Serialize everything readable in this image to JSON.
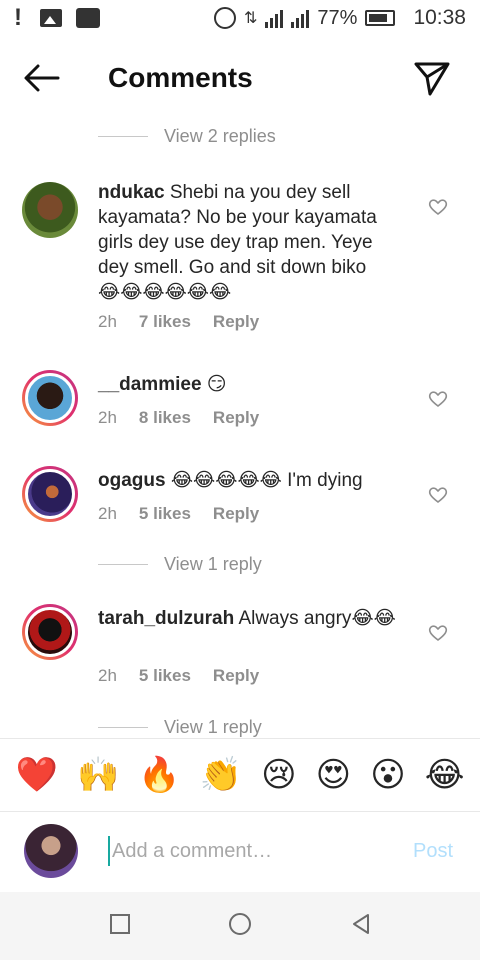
{
  "status_bar": {
    "battery": "77%",
    "time": "10:38",
    "icons": [
      "notification-icon",
      "image-icon",
      "pulse-icon",
      "alarm-icon",
      "data-icon",
      "signal-icon",
      "signal-icon",
      "battery-icon"
    ]
  },
  "header": {
    "title": "Comments",
    "back_icon": "arrow-left-icon",
    "send_icon": "paper-plane-icon"
  },
  "replies_top": "View 2 replies",
  "comments": [
    {
      "username": "ndukac",
      "text": "Shebi na you dey sell kayamata? No be your kayamata girls dey use dey trap men. Yeye dey smell. Go and sit down biko",
      "emojis": "😂😂😂😂😂😂",
      "time": "2h",
      "likes": "7 likes",
      "reply": "Reply"
    },
    {
      "username": "__dammiee",
      "text": "",
      "emojis": "😏",
      "time": "2h",
      "likes": "8 likes",
      "reply": "Reply"
    },
    {
      "username": "ogagus",
      "text": "I'm dying",
      "emojis": "😂😂😂😂😂",
      "time": "2h",
      "likes": "5 likes",
      "reply": "Reply",
      "view_replies": "View 1 reply"
    },
    {
      "username": "tarah_dulzurah",
      "text": "Always angry",
      "emojis": "😂😂",
      "time": "2h",
      "likes": "5 likes",
      "reply": "Reply",
      "view_replies": "View 1 reply"
    }
  ],
  "emoji_bar": [
    "❤️",
    "🙌",
    "🔥",
    "👏",
    "😢",
    "😍",
    "😮",
    "😂"
  ],
  "input": {
    "placeholder": "Add a comment…",
    "post_label": "Post"
  },
  "colors": {
    "accent_disabled": "#b2dffc",
    "muted_text": "#8e8e8e",
    "story_ring_start": "#f9a13a",
    "story_ring_end": "#c13584"
  }
}
